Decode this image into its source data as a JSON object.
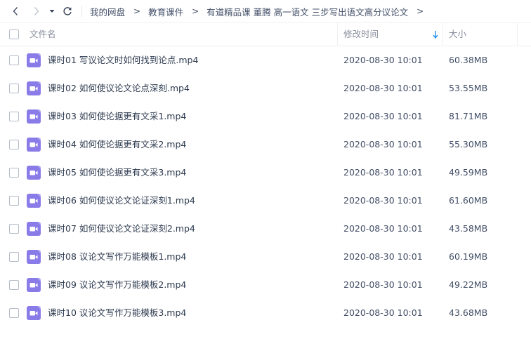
{
  "nav": {
    "back_icon": "chevron-left-icon",
    "forward_icon": "chevron-right-icon",
    "history_icon": "caret-down-icon",
    "refresh_icon": "refresh-icon",
    "breadcrumbs": [
      "我的网盘",
      "教育课件",
      "有道精品课 董腾 高一语文 三步写出语文高分议论文"
    ],
    "separator": ">"
  },
  "columns": {
    "name": "文件名",
    "modified": "修改时间",
    "size": "大小",
    "sort_icon": "sort-down-arrow-icon",
    "sort_color": "#1f8ef1"
  },
  "file_icon": {
    "name": "video-file-icon",
    "color": "#8a7ce8"
  },
  "files": [
    {
      "name": "课时01  写议论文时如何找到论点.mp4",
      "date": "2020-08-30 10:01",
      "size": "60.38MB"
    },
    {
      "name": "课时02  如何使议论文论点深刻.mp4",
      "date": "2020-08-30 10:01",
      "size": "53.55MB"
    },
    {
      "name": "课时03  如何使论据更有文采1.mp4",
      "date": "2020-08-30 10:01",
      "size": "81.71MB"
    },
    {
      "name": "课时04  如何使论据更有文采2.mp4",
      "date": "2020-08-30 10:01",
      "size": "55.30MB"
    },
    {
      "name": "课时05  如何使论据更有文采3.mp4",
      "date": "2020-08-30 10:01",
      "size": "49.59MB"
    },
    {
      "name": "课时06  如何使议论文论证深刻1.mp4",
      "date": "2020-08-30 10:01",
      "size": "61.60MB"
    },
    {
      "name": "课时07  如何使议论文论证深刻2.mp4",
      "date": "2020-08-30 10:01",
      "size": "43.58MB"
    },
    {
      "name": "课时08  议论文写作万能模板1.mp4",
      "date": "2020-08-30 10:01",
      "size": "60.19MB"
    },
    {
      "name": "课时09  议论文写作万能模板2.mp4",
      "date": "2020-08-30 10:01",
      "size": "49.22MB"
    },
    {
      "name": "课时10  议论文写作万能模板3.mp4",
      "date": "2020-08-30 10:01",
      "size": "43.68MB"
    }
  ]
}
